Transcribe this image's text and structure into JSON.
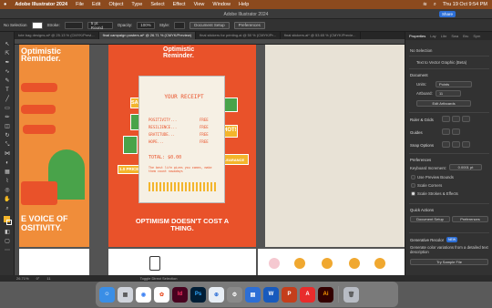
{
  "menubar": {
    "app": "Adobe Illustrator 2024",
    "items": [
      "File",
      "Edit",
      "Object",
      "Type",
      "Select",
      "Effect",
      "View",
      "Window",
      "Help"
    ],
    "datetime": "Thu 19 Oct 9:54 PM"
  },
  "window": {
    "title": "Adobe Illustrator 2024",
    "share": "Share"
  },
  "control": {
    "selection": "No Selection",
    "stroke_label": "Stroke:",
    "brush": "5 pt. Round",
    "opacity_label": "Opacity:",
    "opacity": "100%",
    "style_label": "Style:",
    "doc_setup": "Document Setup",
    "preferences": "Preferences"
  },
  "tabs": [
    {
      "label": "tote bag designs.ai* @ 25.13 % (CMYK/Previ..."
    },
    {
      "label": "final campaign posters.ai* @ 26.71 % (CMYK/Preview)"
    },
    {
      "label": "final stickers for printing.ai @ 50 % (CMYK/Pr..."
    },
    {
      "label": "final stickers.ai* @ 53.65 % (CMYK/Previe..."
    }
  ],
  "artboards": {
    "left_title": "Optimistic Reminder.",
    "left_bottom": "E VOICE OF OSITIVITY.",
    "center_title": "Optimistic Reminder.",
    "receipt": {
      "heading": "YOUR RECEIPT",
      "rows": [
        {
          "k": "POSITIVITY...",
          "v": "FREE"
        },
        {
          "k": "RESILIENCE...",
          "v": "FREE"
        },
        {
          "k": "GRATITUDE...",
          "v": "FREE"
        },
        {
          "k": "HOPE...",
          "v": "FREE"
        }
      ],
      "total": "TOTAL: $0.00",
      "footer": "The best life gives you comes, make them count nowadays"
    },
    "tags": {
      "sale": "SALE",
      "hot": "HOT!",
      "clearance": "CLEARANCE",
      "price": "1.0 PRICE"
    },
    "center_bottom": "OPTIMISM DOESN'T COST A THING."
  },
  "properties": {
    "tabs": [
      "Properties",
      "Lay",
      "Libr",
      "Swa",
      "Bru",
      "Sym"
    ],
    "no_selection": "No Selection",
    "text_vector": "Text to Vector Graphic (Beta)",
    "document": "Document",
    "units_label": "Units:",
    "units": "Points",
    "artboard_label": "Artboard:",
    "artboard": "11",
    "edit_artboards": "Edit Artboards",
    "ruler_grids": "Ruler & Grids",
    "guides": "Guides",
    "snap": "Snap Options",
    "preferences_hdr": "Preferences",
    "keyboard_label": "Keyboard Increment:",
    "keyboard": "0.0001 pt",
    "check1": "Use Preview Bounds",
    "check2": "Scale Corners",
    "check3": "Scale Strokes & Effects",
    "quick_actions": "Quick Actions",
    "doc_setup": "Document Setup",
    "prefs_btn": "Preferences",
    "gen_recolor": "Generative Recolor",
    "new_badge": "NEW",
    "gen_desc": "Generate color variations from a detailed text description",
    "try_sample": "Try Sample File"
  },
  "status": {
    "zoom": "26.71%",
    "rotate": "0°",
    "artboard": "11",
    "tool": "Toggle Direct Selection"
  },
  "dock": [
    "Finder",
    "Launchpad",
    "Chrome",
    "Photos",
    "InDesign",
    "Photoshop",
    "Safari",
    "Settings",
    "Keynote",
    "Word",
    "PowerPoint",
    "Acrobat",
    "Illustrator",
    "Trash"
  ]
}
